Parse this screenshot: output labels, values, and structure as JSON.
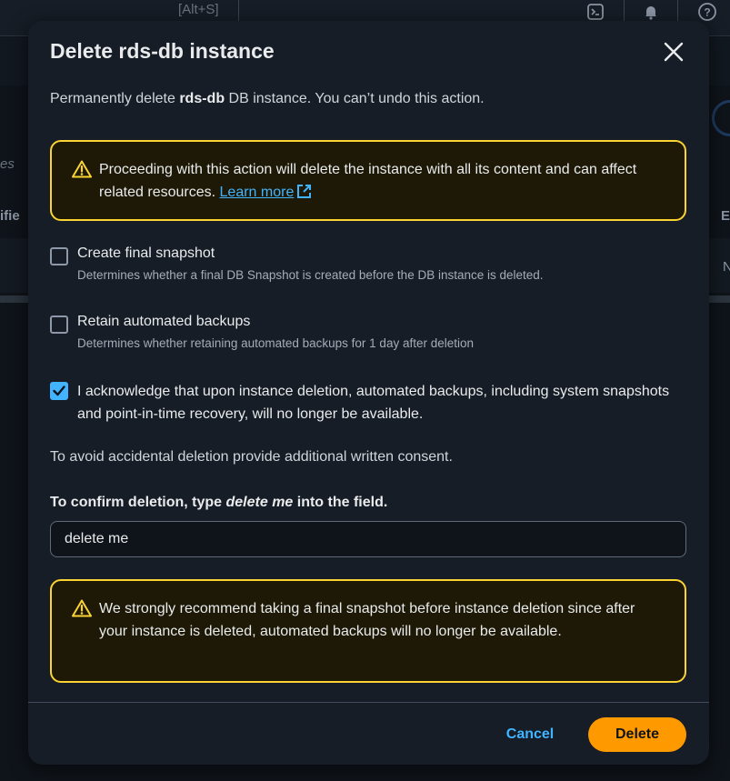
{
  "background": {
    "search_shortcut": "[Alt+S]",
    "search_placeholder_fragment": "es",
    "column_fragment": "ifie",
    "right_col_fragment_1": "E",
    "right_col_fragment_2": "N"
  },
  "modal": {
    "title": "Delete rds-db instance",
    "intro": {
      "prefix": "Permanently delete ",
      "instance_name": "rds-db",
      "suffix": " DB instance. You can’t undo this action."
    },
    "alert_top": {
      "text": "Proceeding with this action will delete the instance with all its content and can affect related resources. ",
      "link_label": "Learn more"
    },
    "options": [
      {
        "label": "Create final snapshot",
        "description": "Determines whether a final DB Snapshot is created before the DB instance is deleted.",
        "checked": false
      },
      {
        "label": "Retain automated backups",
        "description": "Determines whether retaining automated backups for 1 day after deletion",
        "checked": false
      }
    ],
    "acknowledge": {
      "label": "I acknowledge that upon instance deletion, automated backups, including system snapshots and point-in-time recovery, will no longer be available.",
      "checked": true
    },
    "consent_text": "To avoid accidental deletion provide additional written consent.",
    "confirm": {
      "label_prefix": "To confirm deletion, type ",
      "label_keyword": "delete me",
      "label_suffix": " into the field.",
      "value": "delete me"
    },
    "alert_bottom": {
      "text": "We strongly recommend taking a final snapshot before instance deletion since after your instance is deleted, automated backups will no longer be available."
    },
    "footer": {
      "cancel_label": "Cancel",
      "delete_label": "Delete"
    }
  },
  "colors": {
    "modal_bg": "#161d26",
    "warning_border": "#fbd332",
    "link": "#42b4ff",
    "primary_button": "#ff9900"
  }
}
